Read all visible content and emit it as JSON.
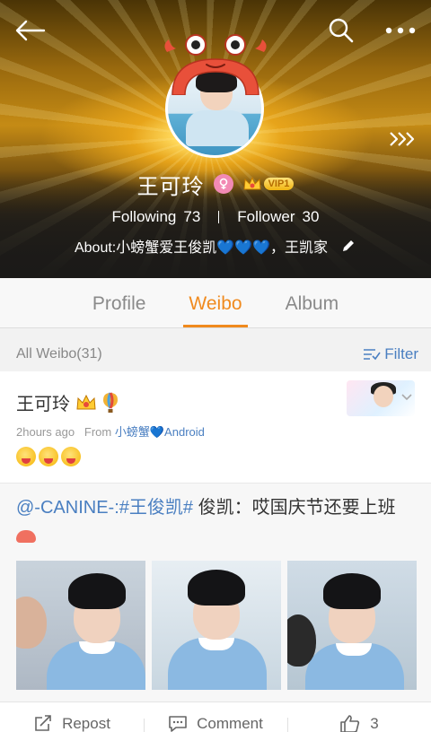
{
  "header": {
    "name": "王可玲",
    "vip_label": "VIP1",
    "following_label": "Following",
    "following_count": "73",
    "follower_label": "Follower",
    "follower_count": "30",
    "about": "About:小螃蟹爱王俊凯💙💙💙，王凯家",
    "icons": [
      "back-arrow-icon",
      "search-icon",
      "more-icon",
      "chevron-right-icon",
      "female-icon",
      "crown-icon",
      "edit-icon"
    ]
  },
  "tabs": [
    {
      "label": "Profile",
      "active": false
    },
    {
      "label": "Weibo",
      "active": true
    },
    {
      "label": "Album",
      "active": false
    }
  ],
  "filter_bar": {
    "count": "All Weibo(31)",
    "filter_label": "Filter"
  },
  "post": {
    "author": "王可玲",
    "time": "2hours ago",
    "from_label": "From",
    "source": "小螃蟹💙Android",
    "repost": {
      "mention": "@-CANINE-",
      "hashtag": ":#王俊凯#",
      "text": " 俊凯：哎国庆节还要上班"
    },
    "actions": {
      "repost_label": "Repost",
      "comment_label": "Comment",
      "like_count": "3"
    }
  },
  "colors": {
    "accent": "#f08a1e",
    "link": "#4a7fc1"
  }
}
